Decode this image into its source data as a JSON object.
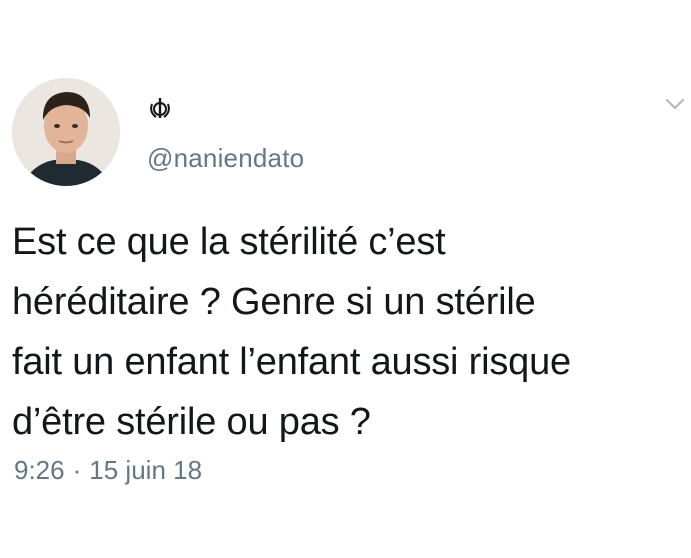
{
  "tweet": {
    "handle": "@naniendato",
    "display_name_icon": "khanda-symbol-icon",
    "text_lines": [
      "Est ce que la stérilité c’est",
      "héréditaire ? Genre si un stérile",
      "fait un enfant l’enfant aussi risque",
      "d’être stérile ou pas ?"
    ],
    "time": "9:26",
    "separator": "·",
    "date": "15 juin 18",
    "menu_icon": "chevron-down-icon",
    "avatar_icon": "profile-photo"
  },
  "colors": {
    "text": "#14171a",
    "secondary_text": "#657786",
    "background": "#ffffff"
  }
}
